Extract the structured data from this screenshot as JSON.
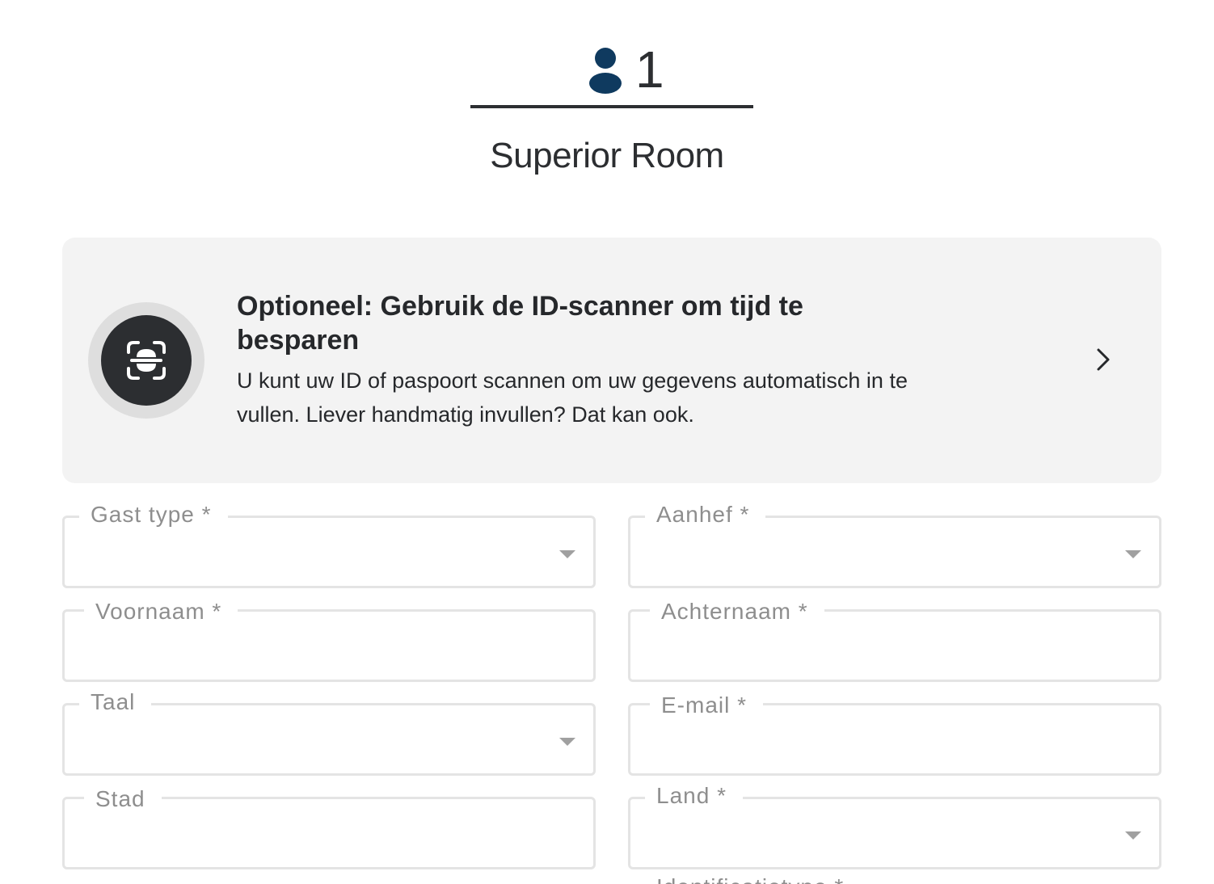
{
  "guest": {
    "count": "1",
    "icon": "person-icon",
    "room_name": "Superior Room"
  },
  "scanner": {
    "icon": "id-scan-icon",
    "title": "Optioneel: Gebruik de ID-scanner om tijd te besparen",
    "description": "U kunt uw ID of paspoort scannen om uw gegevens automatisch in te vullen. Liever handmatig invullen? Dat kan ook.",
    "chevron_icon": "chevron-right-icon"
  },
  "form": {
    "guest_type": {
      "label": "Gast type *",
      "type": "select"
    },
    "salutation": {
      "label": "Aanhef *",
      "type": "select"
    },
    "first_name": {
      "label": "Voornaam *",
      "type": "text"
    },
    "last_name": {
      "label": "Achternaam *",
      "type": "text"
    },
    "language": {
      "label": "Taal",
      "type": "select"
    },
    "email": {
      "label": "E-mail *",
      "type": "text"
    },
    "city": {
      "label": "Stad",
      "type": "text"
    },
    "country": {
      "label": "Land *",
      "type": "select"
    },
    "next_label_partial": "Identificatietype *"
  },
  "colors": {
    "text_dark": "#2c2e31",
    "icon_blue": "#0f3a5f",
    "card_bg": "#f3f3f3",
    "border": "#e4e4e4",
    "label_grey": "#8e8e8e"
  }
}
